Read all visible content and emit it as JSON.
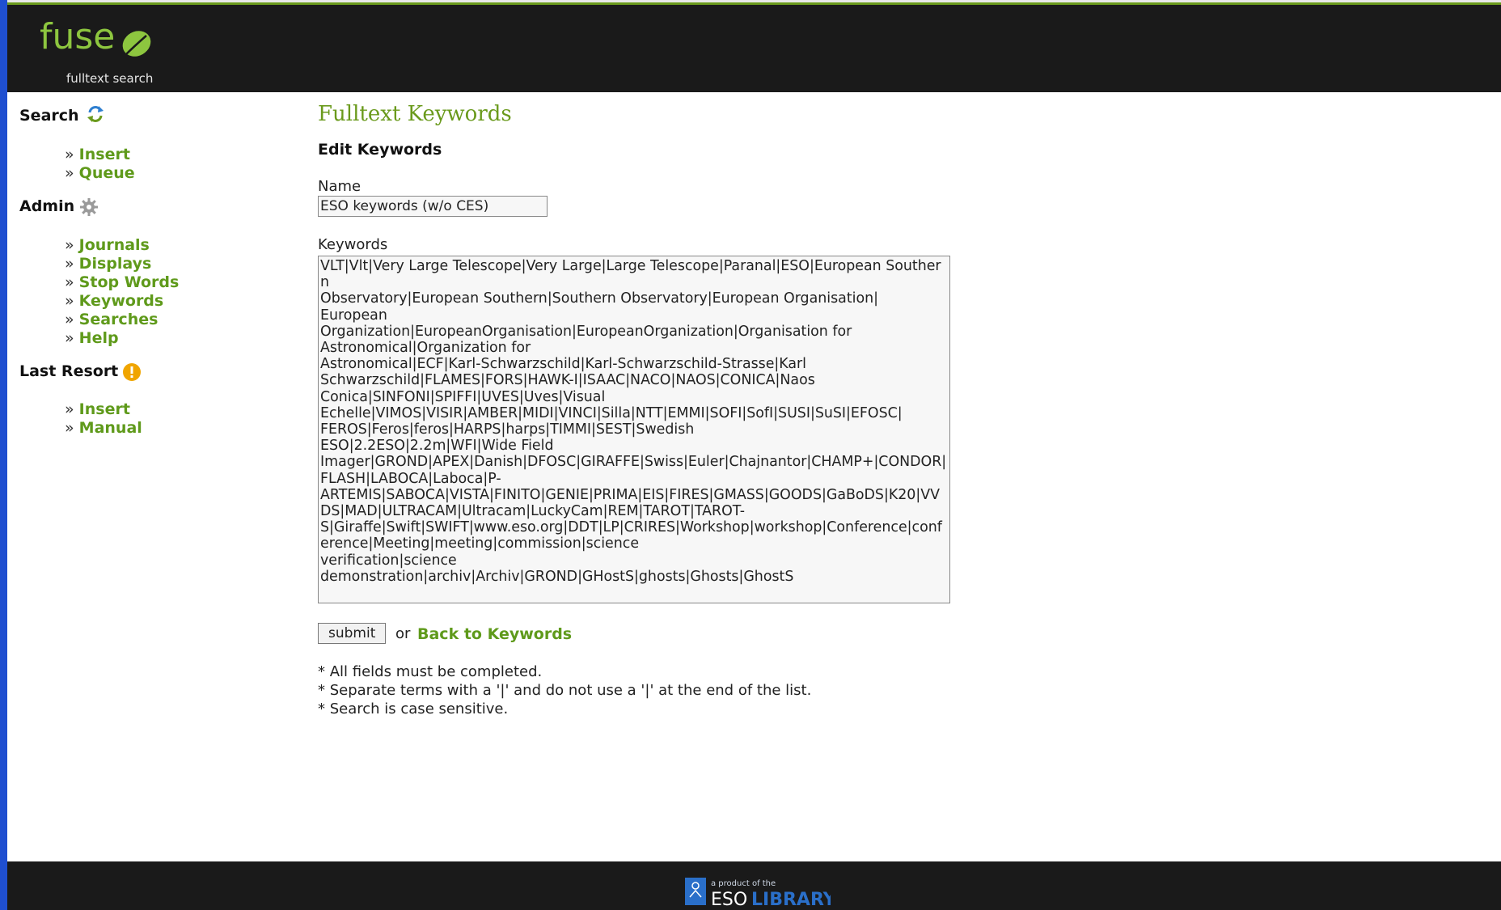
{
  "header": {
    "logo_text": "fuse",
    "logo_subtitle": "fulltext search"
  },
  "sidebar": {
    "sections": [
      {
        "title": "Search",
        "icon": "refresh-icon",
        "items": [
          "Insert",
          "Queue"
        ]
      },
      {
        "title": "Admin",
        "icon": "gear-icon",
        "items": [
          "Journals",
          "Displays",
          "Stop Words",
          "Keywords",
          "Searches",
          "Help"
        ]
      },
      {
        "title": "Last Resort",
        "icon": "warning-icon",
        "items": [
          "Insert",
          "Manual"
        ]
      }
    ],
    "raquo": "»"
  },
  "main": {
    "title": "Fulltext Keywords",
    "subtitle": "Edit Keywords",
    "name_label": "Name",
    "name_value": "ESO keywords (w/o CES)",
    "keywords_label": "Keywords",
    "keywords_value": "VLT|Vlt|Very Large Telescope|Very Large|Large Telescope|Paranal|ESO|European Southern\nObservatory|European Southern|Southern Observatory|European Organisation|\nEuropean\nOrganization|EuropeanOrganisation|EuropeanOrganization|Organisation for\nAstronomical|Organization for\nAstronomical|ECF|Karl-Schwarzschild|Karl-Schwarzschild-Strasse|Karl\nSchwarzschild|FLAMES|FORS|HAWK-I|ISAAC|NACO|NAOS|CONICA|Naos\nConica|SINFONI|SPIFFI|UVES|Uves|Visual\nEchelle|VIMOS|VISIR|AMBER|MIDI|VINCI|Silla|NTT|EMMI|SOFI|SofI|SUSI|SuSI|EFOSC|\nFEROS|Feros|feros|HARPS|harps|TIMMI|SEST|Swedish\nESO|2.2ESO|2.2m|WFI|Wide Field\nImager|GROND|APEX|Danish|DFOSC|GIRAFFE|Swiss|Euler|Chajnantor|CHAMP+|CONDOR|FLASH|LABOCA|Laboca|P-\nARTEMIS|SABOCA|VISTA|FINITO|GENIE|PRIMA|EIS|FIRES|GMASS|GOODS|GaBoDS|K20|VVDS|MAD|ULTRACAM|Ultracam|LuckyCam|REM|TAROT|TAROT-\nS|Giraffe|Swift|SWIFT|www.eso.org|DDT|LP|CRIRES|Workshop|workshop|Conference|conference|Meeting|meeting|commission|science\nverification|science\ndemonstration|archiv|Archiv|GROND|GHostS|ghosts|Ghosts|GhostS",
    "submit_label": "submit",
    "or_text": "or",
    "back_link": "Back to Keywords",
    "notes": [
      "* All fields must be completed.",
      "* Separate terms with a '|' and do not use a '|' at the end of the list.",
      "* Search is case sensitive."
    ]
  },
  "footer": {
    "tagline": "a product of the",
    "brand_eso": "ESO",
    "brand_library": "LIBRARY"
  },
  "colors": {
    "accent_green": "#6a9a1c",
    "link_green": "#5f9a1b",
    "header_bg": "#1a1a1a",
    "left_edge": "#1f4fd0"
  }
}
